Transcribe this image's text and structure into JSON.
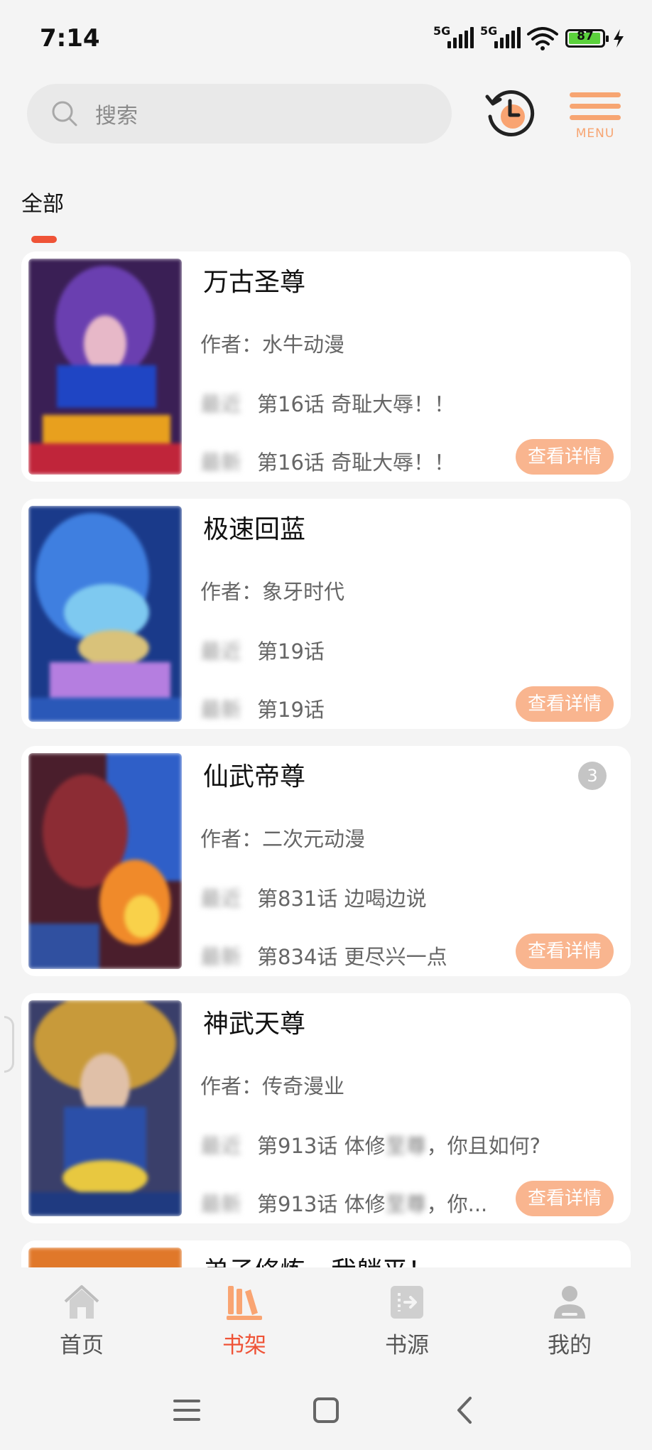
{
  "status_bar": {
    "time": "7:14",
    "signal_1_label": "5G",
    "signal_2_label": "5G",
    "battery": "87",
    "wifi_icon": "wifi-icon",
    "charging_icon": "bolt-icon"
  },
  "search": {
    "placeholder": "搜索"
  },
  "menu": {
    "label": "MENU"
  },
  "tabs": {
    "all": "全部"
  },
  "books": [
    {
      "title": "万古圣尊",
      "author": "作者：水牛动漫",
      "last_label": "最近",
      "last_chapter": "第16话 奇耻大辱！！",
      "latest_label": "最新",
      "latest_chapter": "第16话 奇耻大辱！！",
      "action": "查看详情",
      "badge": ""
    },
    {
      "title": "极速回蓝",
      "author": "作者：象牙时代",
      "last_label": "最近",
      "last_chapter": "第19话",
      "latest_label": "最新",
      "latest_chapter": "第19话",
      "action": "查看详情",
      "badge": ""
    },
    {
      "title": "仙武帝尊",
      "author": "作者：二次元动漫",
      "last_label": "最近",
      "last_chapter": "第831话 边喝边说",
      "latest_label": "最新",
      "latest_chapter": "第834话 更尽兴一点",
      "action": "查看详情",
      "badge": "3"
    },
    {
      "title": "神武天尊",
      "author": "作者：传奇漫业",
      "last_label": "最近",
      "last_chapter_pre": "第913话 体修",
      "last_chapter_blur": "至尊",
      "last_chapter_post": "，你且如何?",
      "latest_label": "最新",
      "latest_chapter_pre": "第913话 体修",
      "latest_chapter_blur": "至尊",
      "latest_chapter_post": "，你...",
      "action": "查看详情",
      "badge": ""
    },
    {
      "title": "弟子修炼，我躺平！"
    }
  ],
  "bottom_nav": [
    {
      "label": "首页",
      "icon": "home-icon"
    },
    {
      "label": "书架",
      "icon": "bookshelf-icon",
      "active": true
    },
    {
      "label": "书源",
      "icon": "book-source-icon"
    },
    {
      "label": "我的",
      "icon": "profile-icon"
    }
  ],
  "colors": {
    "accent": "#ef5337",
    "button": "#f9b58f",
    "menu": "#f7a572"
  }
}
